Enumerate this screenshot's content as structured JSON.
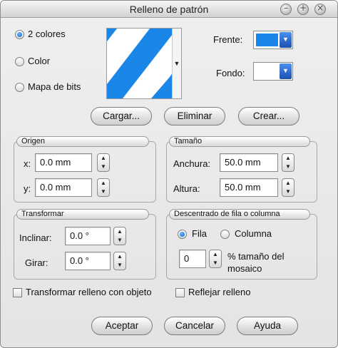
{
  "window": {
    "title": "Relleno de patrón"
  },
  "pattern_type": {
    "options": [
      {
        "label": "2 colores",
        "selected": true
      },
      {
        "label": "Color",
        "selected": false
      },
      {
        "label": "Mapa de bits",
        "selected": false
      }
    ]
  },
  "colors": {
    "front_label": "Frente:",
    "back_label": "Fondo:",
    "front_color": "#1a86e8",
    "back_color": "#ffffff",
    "pattern_color": "#1a86e8"
  },
  "actions": {
    "load": "Cargar...",
    "delete": "Eliminar",
    "create": "Crear..."
  },
  "origin": {
    "title": "Origen",
    "x_label": "x:",
    "x_value": "0.0 mm",
    "y_label": "y:",
    "y_value": "0.0 mm"
  },
  "size": {
    "title": "Tamaño",
    "width_label": "Anchura:",
    "width_value": "50.0 mm",
    "height_label": "Altura:",
    "height_value": "50.0 mm"
  },
  "transform": {
    "title": "Transformar",
    "skew_label": "Inclinar:",
    "skew_value": "0.0 °",
    "rotate_label": "Girar:",
    "rotate_value": "0.0 °"
  },
  "offset": {
    "title": "Descentrado de fila o columna",
    "row_label": "Fila",
    "row_selected": true,
    "column_label": "Columna",
    "column_selected": false,
    "value": "0",
    "percent_label_line1": "% tamaño del",
    "percent_label_line2": "mosaico"
  },
  "options": {
    "transform_with_object": "Transformar relleno con objeto",
    "mirror_fill": "Reflejar relleno"
  },
  "footer": {
    "ok": "Aceptar",
    "cancel": "Cancelar",
    "help": "Ayuda"
  }
}
